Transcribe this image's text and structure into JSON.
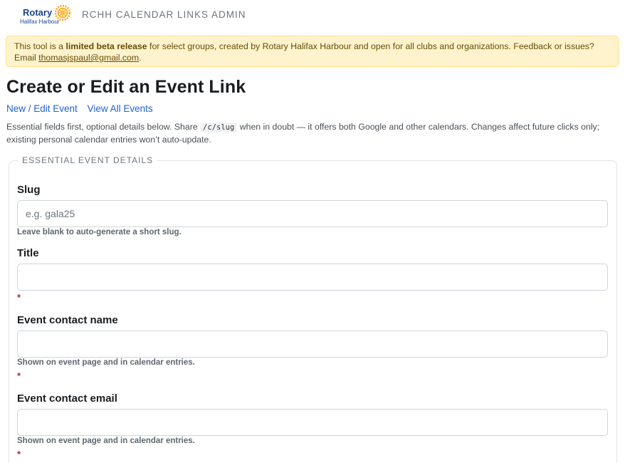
{
  "brand": {
    "logo_word": "Rotary",
    "logo_sub": "Halifax Harbour",
    "logo_icon": "rotary-wheel",
    "accent_color": "#f7a81b",
    "brand_color": "#17458f"
  },
  "header": {
    "app_title": "RCHH CALENDAR LINKS ADMIN"
  },
  "alert": {
    "prefix": "This tool is a ",
    "bold": "limited beta release",
    "middle": " for select groups, created by Rotary Halifax Harbour and open for all clubs and organizations. Feedback or issues? Email ",
    "email": "thomasjspaul@gmail.com",
    "suffix": "."
  },
  "page": {
    "title": "Create or Edit an Event Link"
  },
  "nav": {
    "items": [
      {
        "label": "New / Edit Event"
      },
      {
        "label": "View All Events"
      }
    ]
  },
  "intro": {
    "before_code": "Essential fields first, optional details below. Share ",
    "code": "/c/slug",
    "after_code": " when in doubt — it offers both Google and other calendars. Changes affect future clicks only; existing personal calendar entries won’t auto-update."
  },
  "form": {
    "section_legend": "ESSENTIAL EVENT DETAILS",
    "fields": {
      "slug": {
        "label": "Slug",
        "value": "",
        "placeholder": "e.g. gala25",
        "help": "Leave blank to auto-generate a short slug."
      },
      "title": {
        "label": "Title",
        "value": "",
        "placeholder": "",
        "required_mark": "*"
      },
      "contact_name": {
        "label": "Event contact name",
        "value": "",
        "placeholder": "",
        "help": "Shown on event page and in calendar entries.",
        "required_mark": "*"
      },
      "contact_email": {
        "label": "Event contact email",
        "value": "",
        "placeholder": "",
        "help": "Shown on event page and in calendar entries.",
        "required_mark": "*"
      }
    }
  }
}
